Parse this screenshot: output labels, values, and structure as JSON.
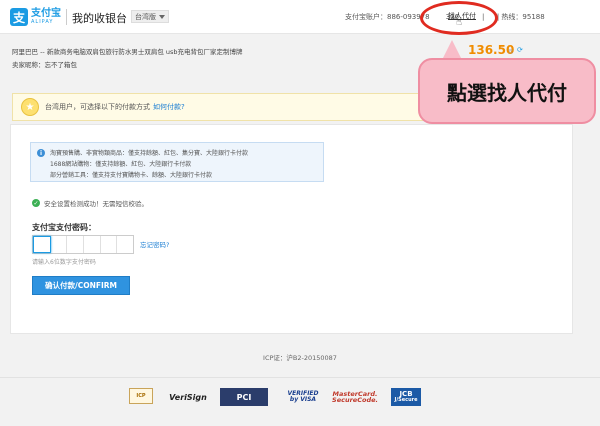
{
  "header": {
    "logo_cn": "支付宝",
    "logo_en": "ALIPAY",
    "logo_glyph": "支",
    "cashier_title": "我的收银台",
    "version_label": "台湾版",
    "account_label": "支付宝账户：",
    "account_value": "886-093978",
    "account_value_tail": "306",
    "pay_for_other": "找人代付",
    "hotline_label": "热线：",
    "hotline_value": "95188",
    "divider_char": "|"
  },
  "order": {
    "title": "阿里巴巴 -- 新款商务电脑双肩包旅行防水男士双肩包 usb充电背包厂家定制博牌",
    "seller_label": "卖家昵称：",
    "seller_value": "忘不了箱包",
    "amount": "136.50",
    "amount_unit": "元"
  },
  "callout": {
    "text": "點選找人代付"
  },
  "notice": {
    "text": "台湾用户，可选择以下的付款方式",
    "link": "如何付款?"
  },
  "info_box": {
    "line1": "淘寶預售購、非實物類商品：僅支持餘額、紅包、集分寶、大陸銀行卡付款",
    "line2": "1688網站購物：僅支持餘額、紅包、大陸銀行卡付款",
    "line3": "部分營銷工具：僅支持支付寶購物卡、餘額、大陸銀行卡付款"
  },
  "security": {
    "text": "安全设置检测成功！无需短信校验。"
  },
  "password": {
    "label": "支付宝支付密码：",
    "forgot_link": "忘记密码?",
    "hint": "请输入6位数字支付密码"
  },
  "confirm_button": "确认付款/CONFIRM",
  "icp": "ICP证：沪B2-20150087",
  "footer_badges": {
    "cert": "ICP",
    "verisign": "VeriSign",
    "pci": "PCI",
    "visa_top": "VERIFIED",
    "visa_bottom": "by VISA",
    "mc_top": "MasterCard.",
    "mc_bottom": "SecureCode.",
    "jcb_top": "JCB",
    "jcb_bottom": "J/Secure"
  },
  "colors": {
    "brand_blue": "#1b9be3",
    "amount_orange": "#f08c00",
    "annotation_red": "#e02b20",
    "callout_pink": "#f8bcc8"
  },
  "icons": {
    "cursor": "hand-pointer-icon",
    "refresh": "refresh-icon",
    "check": "check-icon",
    "info": "info-icon",
    "notice": "star-badge-icon"
  }
}
